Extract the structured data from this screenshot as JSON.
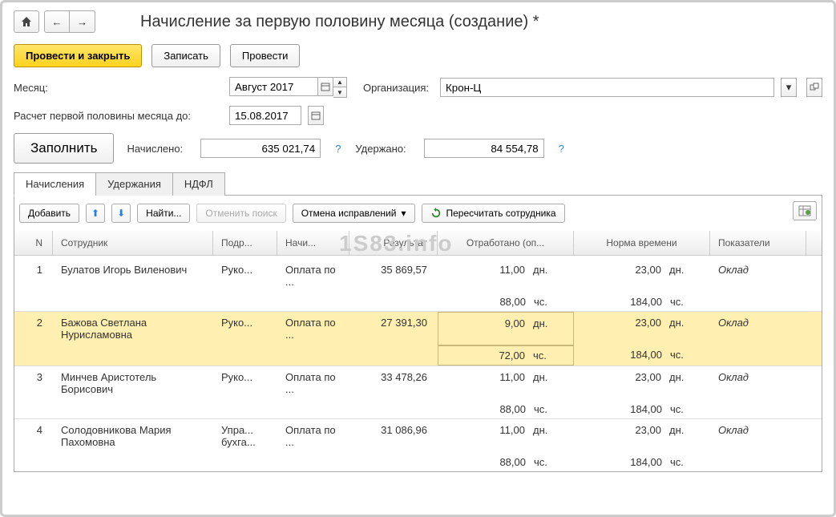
{
  "title": "Начисление за первую половину месяца (создание) *",
  "buttons": {
    "post_close": "Провести и закрыть",
    "save": "Записать",
    "post": "Провести",
    "fill": "Заполнить",
    "add": "Добавить",
    "find": "Найти...",
    "cancel_search": "Отменить поиск",
    "cancel_corrections": "Отмена исправлений",
    "recalc_employee": "Пересчитать сотрудника"
  },
  "labels": {
    "month": "Месяц:",
    "org": "Организация:",
    "calc_until": "Расчет первой половины месяца до:",
    "accrued": "Начислено:",
    "withheld": "Удержано:"
  },
  "values": {
    "month": "Август 2017",
    "org": "Крон-Ц",
    "date": "15.08.2017",
    "accrued": "635 021,74",
    "withheld": "84 554,78"
  },
  "tabs": {
    "accruals": "Начисления",
    "withholdings": "Удержания",
    "ndfl": "НДФЛ"
  },
  "grid": {
    "headers": {
      "n": "N",
      "employee": "Сотрудник",
      "dept": "Подр...",
      "accrual": "Начи...",
      "result": "Результат",
      "worked": "Отработано (оп...",
      "norm": "Норма времени",
      "indicators": "Показатели"
    },
    "units": {
      "days": "дн.",
      "hours": "чс."
    },
    "rows": [
      {
        "n": "1",
        "employee": "Булатов Игорь Виленович",
        "dept": "Руко...",
        "accrual": "Оплата по ...",
        "result": "35 869,57",
        "worked_days": "11,00",
        "worked_hours": "88,00",
        "norm_days": "23,00",
        "norm_hours": "184,00",
        "indicator": "Оклад"
      },
      {
        "n": "2",
        "employee": "Бажова Светлана Нурисламовна",
        "dept": "Руко...",
        "accrual": "Оплата по ...",
        "result": "27 391,30",
        "worked_days": "9,00",
        "worked_hours": "72,00",
        "norm_days": "23,00",
        "norm_hours": "184,00",
        "indicator": "Оклад",
        "highlight": true
      },
      {
        "n": "3",
        "employee": "Минчев Аристотель Борисович",
        "dept": "Руко...",
        "accrual": "Оплата по ...",
        "result": "33 478,26",
        "worked_days": "11,00",
        "worked_hours": "88,00",
        "norm_days": "23,00",
        "norm_hours": "184,00",
        "indicator": "Оклад"
      },
      {
        "n": "4",
        "employee": "Солодовникова Мария Пахомовна",
        "dept": "Упра... бухга...",
        "accrual": "Оплата по ...",
        "result": "31 086,96",
        "worked_days": "11,00",
        "worked_hours": "88,00",
        "norm_days": "23,00",
        "norm_hours": "184,00",
        "indicator": "Оклад"
      }
    ]
  },
  "watermark": "1S83.info"
}
